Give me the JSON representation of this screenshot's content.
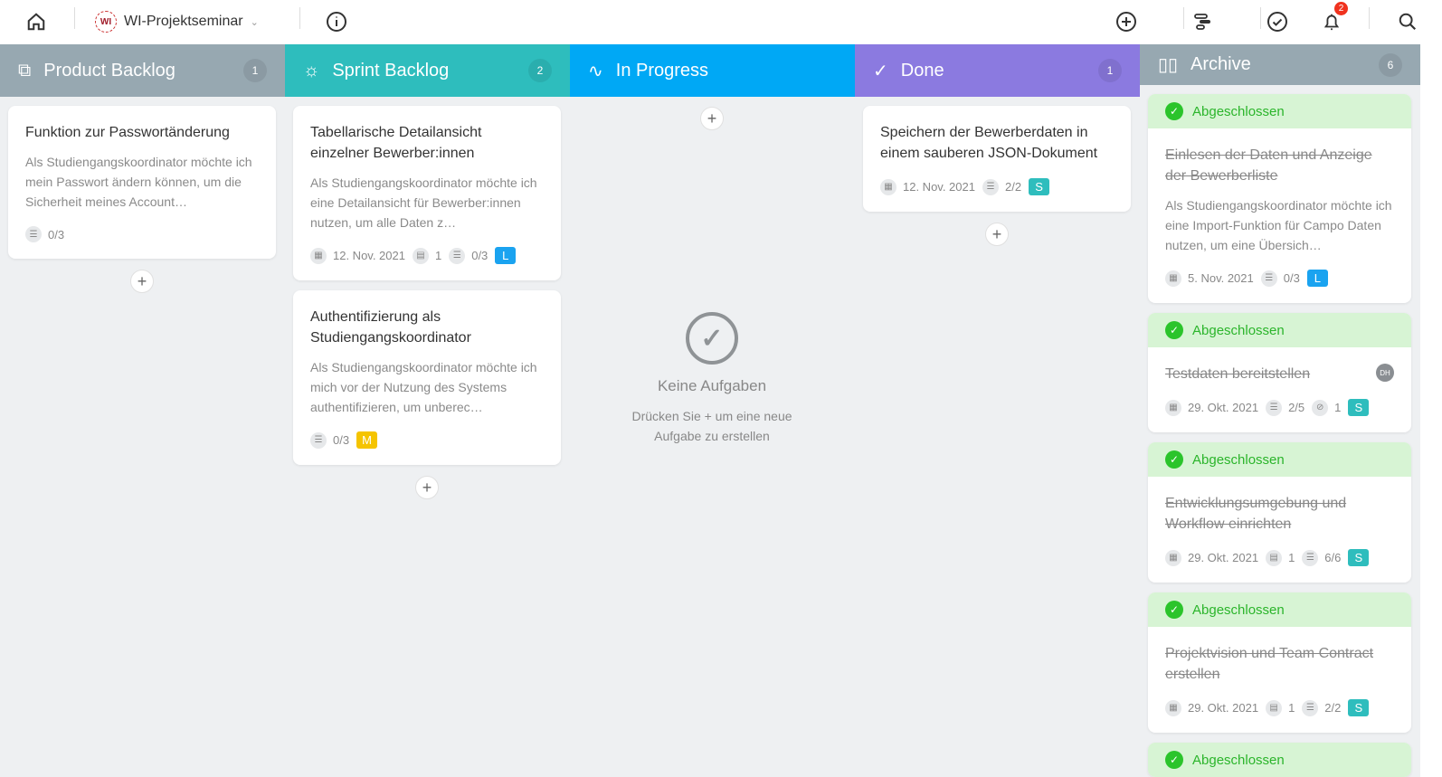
{
  "topbar": {
    "project": "WI-Projektseminar",
    "logo_text": "WI",
    "notifications": "2"
  },
  "colors": {
    "product": "#97a8b1",
    "sprint": "#2ebdbd",
    "progress": "#00a8f5",
    "done": "#8b7ae0",
    "archive": "#97a8b1",
    "size_L": "#1aa3f0",
    "size_M": "#f5c400",
    "size_S": "#2ebdbd"
  },
  "columns": [
    {
      "key": "product",
      "title": "Product Backlog",
      "count": "1",
      "icon": "briefcase-icon",
      "glyph": "⧉",
      "cards": [
        {
          "title": "Funktion zur Passwortänderung",
          "desc": "Als Studiengangskoordinator möchte ich mein Passwort ändern können, um die Sicherheit meines Account…",
          "meta": [
            {
              "type": "checklist",
              "value": "0/3"
            }
          ]
        }
      ]
    },
    {
      "key": "sprint",
      "title": "Sprint Backlog",
      "count": "2",
      "icon": "lightbulb-icon",
      "glyph": "☼",
      "cards": [
        {
          "title": "Tabellarische Detailansicht einzelner Bewerber:innen",
          "desc": "Als Studiengangskoordinator möchte ich eine Detailansicht für Bewerber:innen nutzen, um alle Daten z…",
          "meta": [
            {
              "type": "date",
              "value": "12. Nov. 2021"
            },
            {
              "type": "comments",
              "value": "1"
            },
            {
              "type": "checklist",
              "value": "0/3"
            },
            {
              "type": "size",
              "value": "L"
            }
          ]
        },
        {
          "title": "Authentifizierung als Studiengangskoordinator",
          "desc": "Als Studiengangskoordinator möchte ich mich vor der Nutzung des Systems authentifizieren, um unberec…",
          "meta": [
            {
              "type": "checklist",
              "value": "0/3"
            },
            {
              "type": "size",
              "value": "M"
            }
          ]
        }
      ]
    },
    {
      "key": "progress",
      "title": "In Progress",
      "count": "",
      "icon": "activity-icon",
      "glyph": "∿",
      "cards": [],
      "empty": {
        "title": "Keine Aufgaben",
        "subtitle": "Drücken Sie + um eine neue Aufgabe zu erstellen"
      }
    },
    {
      "key": "done",
      "title": "Done",
      "count": "1",
      "icon": "check-circle-icon",
      "glyph": "✓",
      "cards": [
        {
          "title": "Speichern der Bewerberdaten in einem sauberen JSON-Dokument",
          "meta": [
            {
              "type": "date",
              "value": "12. Nov. 2021"
            },
            {
              "type": "checklist",
              "value": "2/2"
            },
            {
              "type": "size",
              "value": "S"
            }
          ]
        }
      ]
    },
    {
      "key": "archive",
      "title": "Archive",
      "count": "6",
      "icon": "book-icon",
      "glyph": "▯▯",
      "cards": [
        {
          "status": "Abgeschlossen",
          "title": "Einlesen der Daten und Anzeige der Bewerberliste",
          "desc": "Als Studiengangskoordinator möchte ich eine Import-Funktion für Campo Daten nutzen, um eine Übersich…",
          "meta": [
            {
              "type": "date",
              "value": "5. Nov. 2021"
            },
            {
              "type": "checklist",
              "value": "0/3"
            },
            {
              "type": "size",
              "value": "L"
            }
          ]
        },
        {
          "status": "Abgeschlossen",
          "title": "Testdaten bereitstellen",
          "avatar": "DH",
          "meta": [
            {
              "type": "date",
              "value": "29. Okt. 2021"
            },
            {
              "type": "checklist",
              "value": "2/5"
            },
            {
              "type": "attachments",
              "value": "1"
            },
            {
              "type": "size",
              "value": "S"
            }
          ]
        },
        {
          "status": "Abgeschlossen",
          "title": "Entwicklungsumgebung und Workflow einrichten",
          "meta": [
            {
              "type": "date",
              "value": "29. Okt. 2021"
            },
            {
              "type": "comments",
              "value": "1"
            },
            {
              "type": "checklist",
              "value": "6/6"
            },
            {
              "type": "size",
              "value": "S"
            }
          ]
        },
        {
          "status": "Abgeschlossen",
          "title": "Projektvision und Team Contract erstellen",
          "meta": [
            {
              "type": "date",
              "value": "29. Okt. 2021"
            },
            {
              "type": "comments",
              "value": "1"
            },
            {
              "type": "checklist",
              "value": "2/2"
            },
            {
              "type": "size",
              "value": "S"
            }
          ]
        },
        {
          "status": "Abgeschlossen",
          "title": "",
          "meta": []
        }
      ]
    }
  ]
}
